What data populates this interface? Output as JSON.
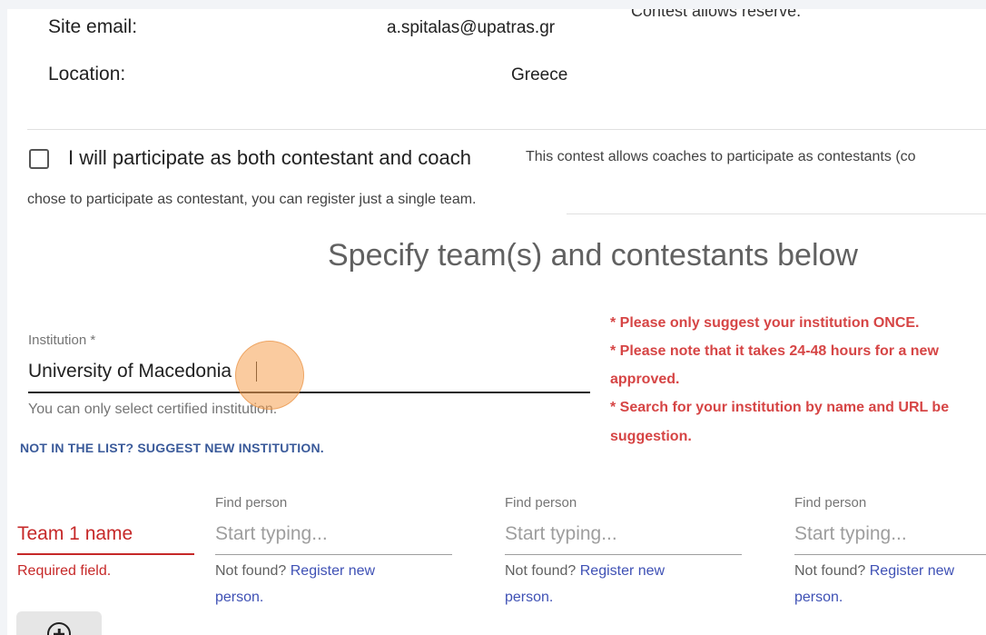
{
  "contest_info": {
    "site_email_label": "Site email:",
    "site_email_value": "a.spitalas@upatras.gr",
    "location_label": "Location:",
    "location_value": "Greece",
    "reserve_note": "Contest allows reserve."
  },
  "participation": {
    "checkbox_label": "I will participate as both contestant and coach",
    "checked": false,
    "note_line1": "This contest allows coaches to participate as contestants (co",
    "note_line2": "chose to participate as contestant, you can register just a single team."
  },
  "section_title": "Specify team(s) and contestants below",
  "institution": {
    "label": "Institution *",
    "value": "University of Macedonia",
    "hint": "You can only select certified institution.",
    "suggest_link": "NOT IN THE LIST? SUGGEST NEW INSTITUTION."
  },
  "warnings": {
    "line1": "* Please only suggest your institution ONCE.",
    "line2": "* Please note that it takes 24-48 hours for a new",
    "line3": "approved.",
    "line4": "* Search for your institution by name and URL be",
    "line5": "suggestion."
  },
  "team": {
    "name_placeholder": "Team 1 name",
    "required_text": "Required field."
  },
  "persons": [
    {
      "label": "Find person",
      "placeholder": "Start typing...",
      "not_found": "Not found?",
      "register_link_1": "Register new",
      "register_link_2": "person."
    },
    {
      "label": "Find person",
      "placeholder": "Start typing...",
      "not_found": "Not found?",
      "register_link_1": "Register new",
      "register_link_2": "person."
    },
    {
      "label": "Find person",
      "placeholder": "Start typing...",
      "not_found": "Not found?",
      "register_link_1": "Register new",
      "register_link_2": "person."
    }
  ],
  "icons": {
    "add_team": "plus-circle-icon"
  }
}
